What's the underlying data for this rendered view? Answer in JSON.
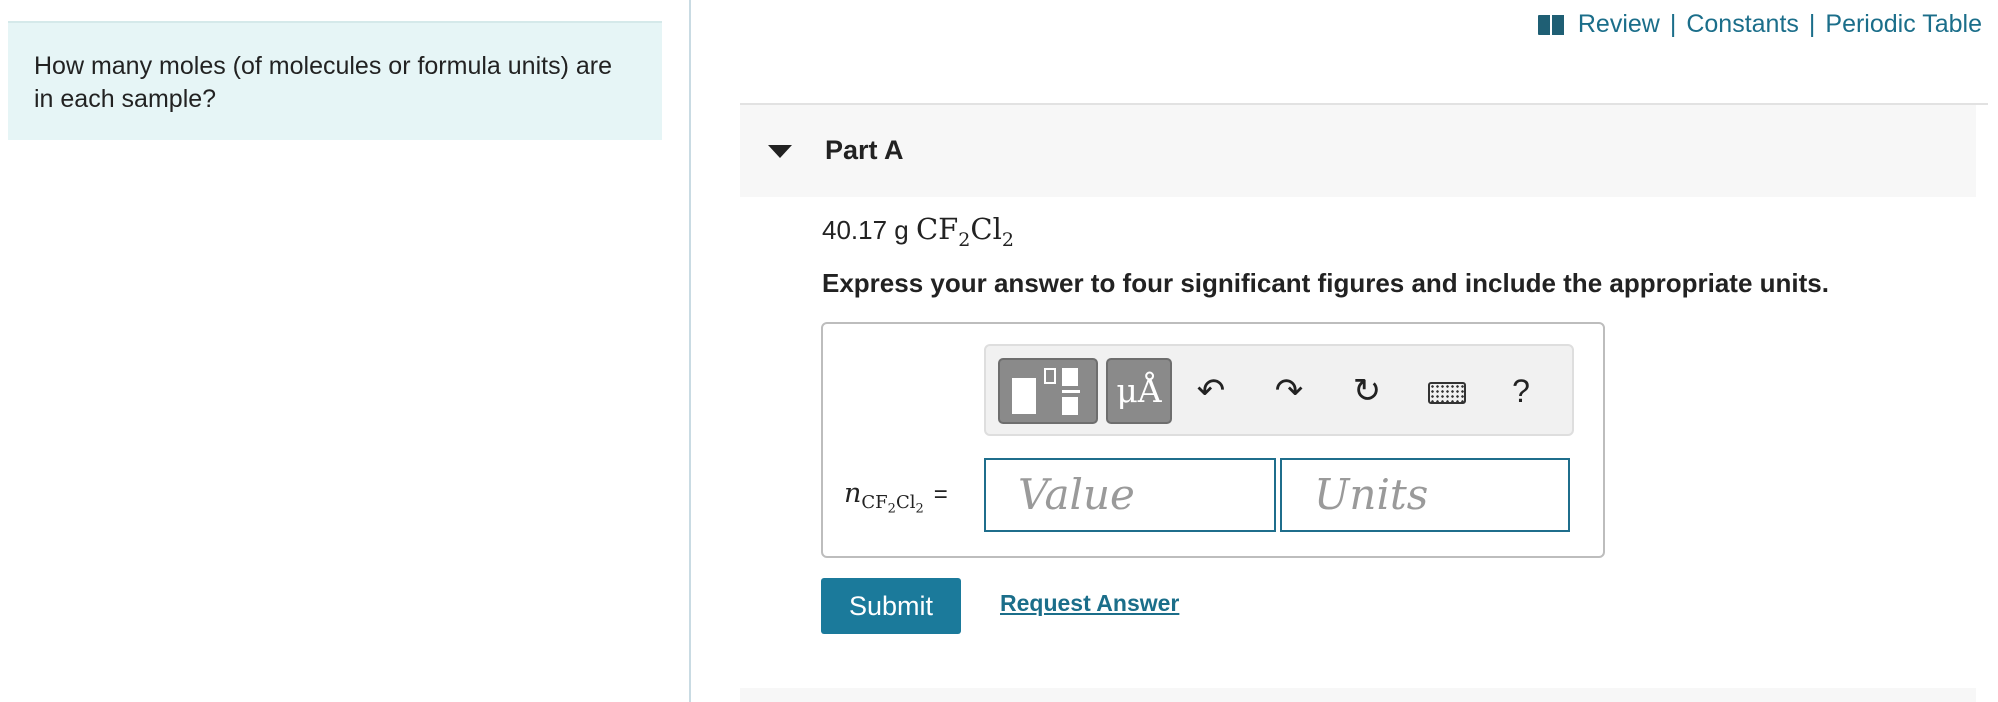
{
  "question": {
    "text": "How many moles (of molecules or formula units) are in each sample?"
  },
  "top_links": {
    "review": "Review",
    "separator": "|",
    "constants": "Constants",
    "periodic_table": "Periodic Table"
  },
  "part": {
    "title": "Part A",
    "sample_mass": "40.17 g",
    "formula_base": "CF",
    "formula_sub1": "2",
    "formula_mid": "Cl",
    "formula_sub2": "2",
    "instructions": "Express your answer to four significant figures and include the appropriate units."
  },
  "toolbar": {
    "units_button": "μÅ",
    "undo": "↶",
    "redo": "↷",
    "reset": "↻",
    "help": "?"
  },
  "answer": {
    "variable": "n",
    "var_sub_a": "CF",
    "var_sub_a2": "2",
    "var_sub_b": "Cl",
    "var_sub_b2": "2",
    "equals": "=",
    "value_placeholder": "Value",
    "units_placeholder": "Units"
  },
  "actions": {
    "submit": "Submit",
    "request_answer": "Request Answer"
  },
  "colors": {
    "accent": "#1b7a9b",
    "link": "#1b6e8a",
    "question_bg": "#e6f5f6"
  }
}
